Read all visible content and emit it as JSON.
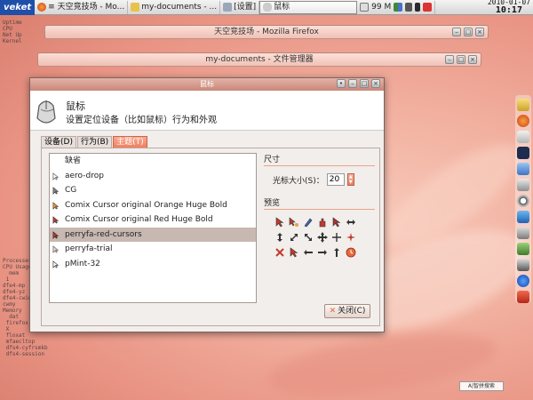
{
  "panel": {
    "logo": "veket",
    "tasks": [
      {
        "label": "≡ 天空竞技场 - Mo..."
      },
      {
        "label": "my-documents - ..."
      },
      {
        "label": "[设置]"
      }
    ],
    "active_task": "鼠标",
    "cpu_value": "99 M",
    "date": "2010-01-07",
    "time": "10:17"
  },
  "windows": {
    "firefox_title": "天空竞技场 - Mozilla Firefox",
    "filemanager_title": "my-documents - 文件管理器"
  },
  "dialog": {
    "title": "鼠标",
    "heading": "鼠标",
    "subtitle": "设置定位设备（比如鼠标）行为和外观",
    "tabs": [
      {
        "label": "设备(D)"
      },
      {
        "label": "行为(B)"
      },
      {
        "label": "主题(T)"
      }
    ],
    "selected_tab": 2,
    "themes": [
      {
        "label": "缺省"
      },
      {
        "label": "aero-drop"
      },
      {
        "label": "CG"
      },
      {
        "label": "Comix Cursor original Orange Huge Bold"
      },
      {
        "label": "Comix Cursor original Red Huge Bold"
      },
      {
        "label": "perryfa-red-cursors"
      },
      {
        "label": "perryfa-trial"
      },
      {
        "label": "pMint-32"
      }
    ],
    "selected_theme": 5,
    "size_section": "尺寸",
    "size_label": "光标大小(S)：",
    "size_value": "20",
    "preview_section": "预览",
    "close_label": "关闭(C)"
  },
  "ime": "A|智拼搜索",
  "colors": {
    "accent": "#ef7c5c",
    "titlebar": "#c9877a",
    "selection": "#c7b8b1",
    "logo_bg": "#1f4fa8"
  }
}
